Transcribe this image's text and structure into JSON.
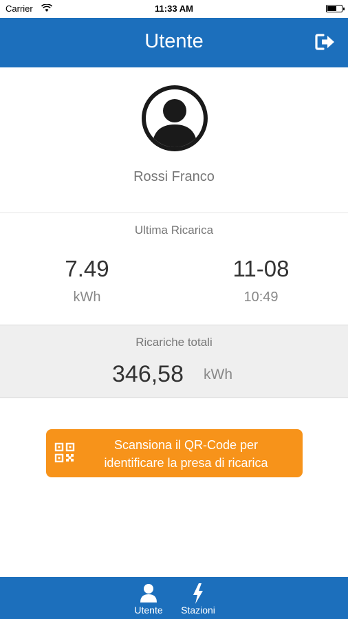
{
  "status_bar": {
    "carrier": "Carrier",
    "time": "11:33 AM"
  },
  "nav": {
    "title": "Utente",
    "logout_icon": "logout-icon"
  },
  "profile": {
    "name": "Rossi Franco",
    "avatar_icon": "user-avatar-icon"
  },
  "last_charge": {
    "label": "Ultima Ricarica",
    "energy_value": "7.49",
    "energy_unit": "kWh",
    "date": "11-08",
    "time": "10:49"
  },
  "totals": {
    "label": "Ricariche totali",
    "value": "346,58",
    "unit": "kWh"
  },
  "qr_button": {
    "line1": "Scansiona il QR-Code per",
    "line2": "identificare la presa di ricarica",
    "icon": "qr-code-icon"
  },
  "tabs": [
    {
      "label": "Utente",
      "icon": "user-icon"
    },
    {
      "label": "Stazioni",
      "icon": "lightning-icon"
    }
  ],
  "colors": {
    "primary": "#1c6fbc",
    "accent": "#f7931a",
    "panel": "#efefef"
  }
}
